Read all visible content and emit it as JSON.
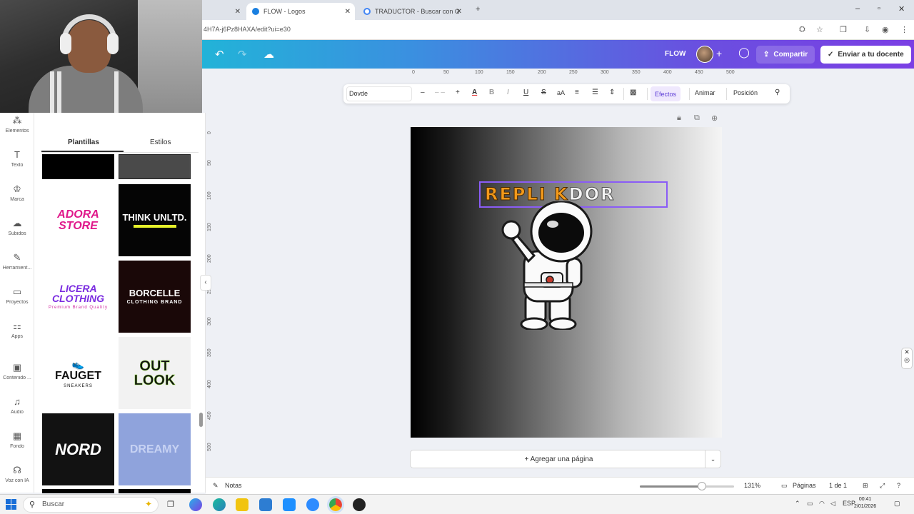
{
  "browser": {
    "tabs": [
      {
        "label": "",
        "active": false
      },
      {
        "label": "FLOW - Logos",
        "active": true
      },
      {
        "label": "TRADUCTOR - Buscar con Goo",
        "active": false
      }
    ],
    "url": "4H7A-j6Pz8HAXA/edit?ui=e30"
  },
  "header": {
    "project_name": "FLOW",
    "share_label": "Compartir",
    "send_label": "Enviar a tu docente"
  },
  "rail": {
    "items": [
      {
        "label": "Elementos",
        "icon": "elements-icon"
      },
      {
        "label": "Texto",
        "icon": "text-icon"
      },
      {
        "label": "Marca",
        "icon": "brand-icon"
      },
      {
        "label": "Subidos",
        "icon": "upload-icon"
      },
      {
        "label": "Herramient...",
        "icon": "tools-icon"
      },
      {
        "label": "Proyectos",
        "icon": "folder-icon"
      },
      {
        "label": "Apps",
        "icon": "apps-icon"
      },
      {
        "label": "Contenido ...",
        "icon": "content-icon"
      },
      {
        "label": "Audio",
        "icon": "audio-icon"
      },
      {
        "label": "Fondo",
        "icon": "background-icon"
      },
      {
        "label": "Voz con IA",
        "icon": "voice-icon"
      }
    ]
  },
  "panel": {
    "tabs": [
      "Plantillas",
      "Estilos"
    ],
    "templates": [
      {
        "title": "ADORA STORE",
        "subtitle": "",
        "bg": "#ffffff",
        "fg": "#e0198b"
      },
      {
        "title": "THINK UNLTD.",
        "subtitle": "",
        "bg": "#050505",
        "fg": "#ffffff"
      },
      {
        "title": "LICERA CLOTHING",
        "subtitle": "Premium Brand Quality",
        "bg": "#ffffff",
        "fg": "#7a2be0"
      },
      {
        "title": "BORCELLE",
        "subtitle": "CLOTHING BRAND",
        "bg": "#1a0808",
        "fg": "#ffffff"
      },
      {
        "title": "FAUGET",
        "subtitle": "SNEAKERS",
        "bg": "#ffffff",
        "fg": "#111111"
      },
      {
        "title": "OUT LOOK",
        "subtitle": "",
        "bg": "#f2f2f2",
        "fg": "#111111"
      },
      {
        "title": "NORD",
        "subtitle": "",
        "bg": "#121212",
        "fg": "#ffffff"
      },
      {
        "title": "DREAMY",
        "subtitle": "",
        "bg": "#8fa3dc",
        "fg": "#c7d2f3"
      }
    ]
  },
  "rulers": {
    "top": [
      "0",
      "50",
      "100",
      "150",
      "200",
      "250",
      "300",
      "350",
      "400",
      "450",
      "500"
    ],
    "left": [
      "0",
      "50",
      "100",
      "150",
      "200",
      "250",
      "300",
      "350",
      "400",
      "450",
      "500"
    ]
  },
  "toolbar": {
    "font": "Dovde",
    "effects": "Efectos",
    "animate": "Animar",
    "position": "Posición"
  },
  "canvas": {
    "logo_text_orange": "REPLI K",
    "logo_text_white": "DOR"
  },
  "add_page_label": "+ Agregar una página",
  "footer": {
    "notes": "Notas",
    "zoom": "131%",
    "zoom_level": 0.66,
    "pages": "Páginas",
    "page_count": "1 de 1"
  },
  "taskbar": {
    "search_placeholder": "Buscar",
    "lang": "ESP",
    "time": "00:41",
    "date": "2/01/2026"
  },
  "colors": {
    "accent": "#8a5cf6",
    "logo_orange": "#f39a1b"
  }
}
